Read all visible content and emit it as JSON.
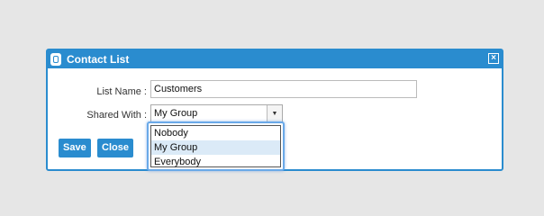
{
  "dialog": {
    "title": "Contact List",
    "close_symbol": "×"
  },
  "form": {
    "list_name_label": "List Name :",
    "list_name_value": "Customers",
    "shared_with_label": "Shared With :",
    "shared_with_value": "My Group",
    "dropdown_arrow": "▼"
  },
  "dropdown": {
    "options": [
      "Nobody",
      "My Group",
      "Everybody"
    ],
    "selected_index": 1
  },
  "buttons": {
    "save": "Save",
    "close": "Close"
  },
  "colors": {
    "accent": "#2a8ccf",
    "selected_option": "#dbeaf7",
    "focus_ring": "#6aa9e8"
  },
  "icons": {
    "app": "app-logo-icon",
    "close": "close-icon",
    "dropdown": "chevron-down-icon"
  }
}
